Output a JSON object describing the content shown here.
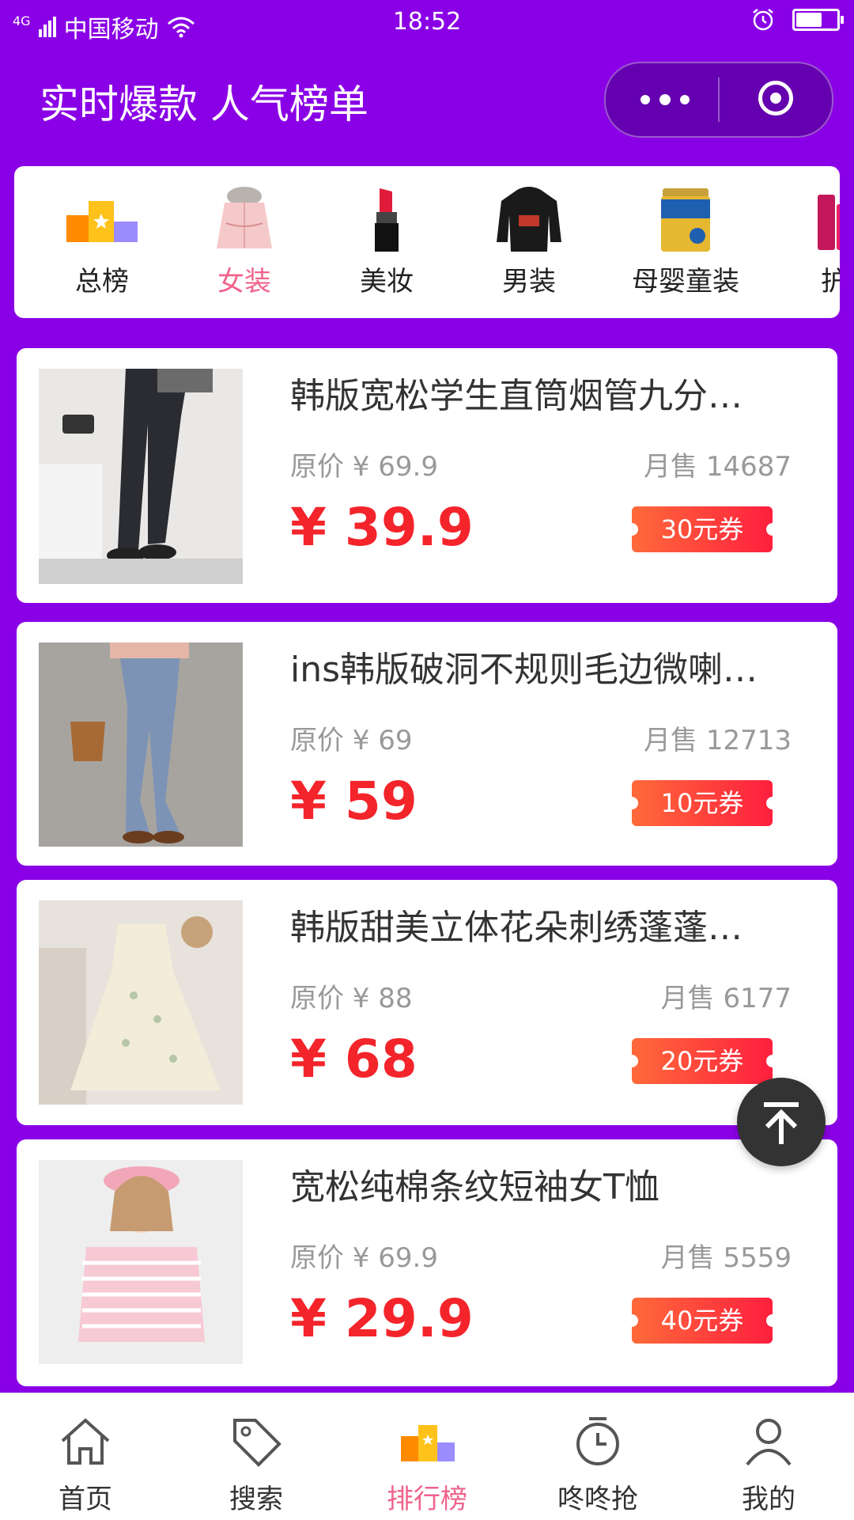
{
  "status_bar": {
    "network": "4G",
    "carrier": "中国移动",
    "time": "18:52"
  },
  "header": {
    "title": "实时爆款 人气榜单"
  },
  "categories": [
    {
      "label": "总榜",
      "icon": "ranking-icon"
    },
    {
      "label": "女装",
      "icon": "womens-coat-image",
      "active": true
    },
    {
      "label": "美妆",
      "icon": "lipstick-image"
    },
    {
      "label": "男装",
      "icon": "hoodie-image"
    },
    {
      "label": "母婴童装",
      "icon": "milk-formula-image"
    },
    {
      "label": "护",
      "icon": "skincare-image"
    }
  ],
  "products": [
    {
      "title": "韩版宽松学生直筒烟管九分…",
      "orig_price": "原价 ¥ 69.9",
      "sales": "月售 14687",
      "price": "¥ 39.9",
      "coupon": "30元券"
    },
    {
      "title": "ins韩版破洞不规则毛边微喇…",
      "orig_price": "原价 ¥ 69",
      "sales": "月售 12713",
      "price": "¥ 59",
      "coupon": "10元券"
    },
    {
      "title": "韩版甜美立体花朵刺绣蓬蓬…",
      "orig_price": "原价 ¥ 88",
      "sales": "月售 6177",
      "price": "¥ 68",
      "coupon": "20元券"
    },
    {
      "title": "宽松纯棉条纹短袖女T恤",
      "orig_price": "原价 ¥ 69.9",
      "sales": "月售 5559",
      "price": "¥ 29.9",
      "coupon": "40元券"
    }
  ],
  "tabbar": [
    {
      "label": "首页",
      "icon": "home-icon"
    },
    {
      "label": "搜索",
      "icon": "tag-icon"
    },
    {
      "label": "排行榜",
      "icon": "ranking-icon",
      "active": true
    },
    {
      "label": "咚咚抢",
      "icon": "alarm-clock-icon"
    },
    {
      "label": "我的",
      "icon": "user-icon"
    }
  ],
  "colors": {
    "header_bg": "#8a00e6",
    "active_label": "#f0638c",
    "price": "#f4242b",
    "coupon_start": "#ff6a3a",
    "coupon_end": "#ff1f3e"
  }
}
